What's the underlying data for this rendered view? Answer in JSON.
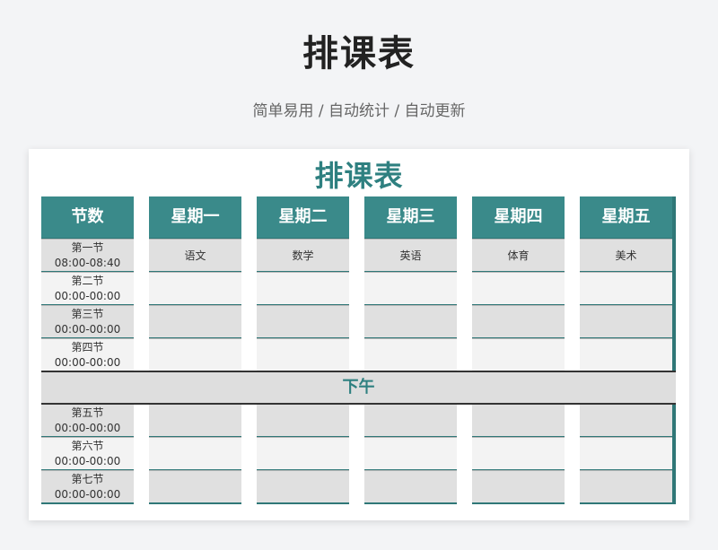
{
  "page": {
    "title": "排课表",
    "subtitle": "简单易用 / 自动统计 / 自动更新"
  },
  "sheet": {
    "title": "排课表",
    "afternoon_label": "下午",
    "headers": [
      "节数",
      "星期一",
      "星期二",
      "星期三",
      "星期四",
      "星期五"
    ],
    "periods": [
      {
        "name": "第一节",
        "time": "08:00-08:40",
        "courses": [
          "语文",
          "数学",
          "英语",
          "体育",
          "美术"
        ]
      },
      {
        "name": "第二节",
        "time": "00:00-00:00",
        "courses": [
          "",
          "",
          "",
          "",
          ""
        ]
      },
      {
        "name": "第三节",
        "time": "00:00-00:00",
        "courses": [
          "",
          "",
          "",
          "",
          ""
        ]
      },
      {
        "name": "第四节",
        "time": "00:00-00:00",
        "courses": [
          "",
          "",
          "",
          "",
          ""
        ]
      },
      {
        "name": "第五节",
        "time": "00:00-00:00",
        "courses": [
          "",
          "",
          "",
          "",
          ""
        ]
      },
      {
        "name": "第六节",
        "time": "00:00-00:00",
        "courses": [
          "",
          "",
          "",
          "",
          ""
        ]
      },
      {
        "name": "第七节",
        "time": "00:00-00:00",
        "courses": [
          "",
          "",
          "",
          "",
          ""
        ]
      }
    ]
  },
  "colors": {
    "accent": "#2e8080",
    "header_bg": "#3a8a8a",
    "row_odd": "#e0e0e0",
    "row_even": "#f3f3f3"
  }
}
